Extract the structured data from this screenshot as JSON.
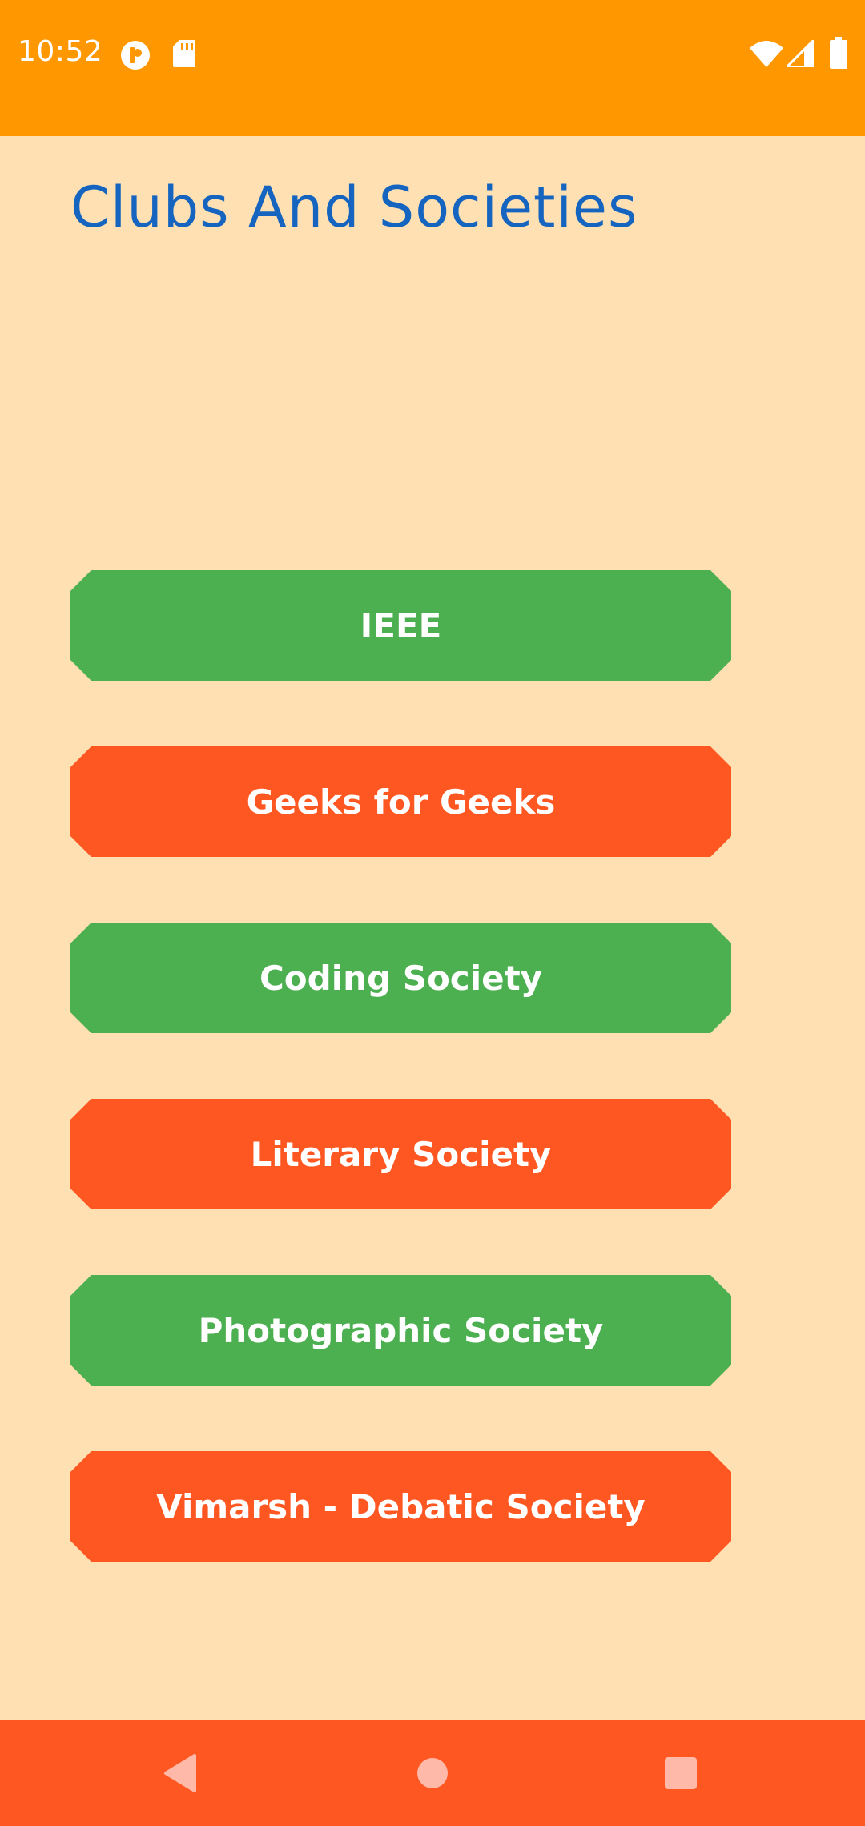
{
  "status_bar": {
    "time": "10:52",
    "background_color": "#FF9800",
    "left_icons": [
      "app-notification-icon",
      "sd-card-icon"
    ],
    "right_icons": [
      "wifi-icon",
      "cell-signal-icon",
      "battery-icon"
    ]
  },
  "page": {
    "title": "Clubs And Societies",
    "background_color": "#FFE0B2",
    "title_color": "#1565C0"
  },
  "clubs": [
    {
      "label": "IEEE",
      "color": "#4CAF50"
    },
    {
      "label": "Geeks for Geeks",
      "color": "#FF5722"
    },
    {
      "label": "Coding Society",
      "color": "#4CAF50"
    },
    {
      "label": "Literary Society",
      "color": "#FF5722"
    },
    {
      "label": "Photographic Society",
      "color": "#4CAF50"
    },
    {
      "label": "Vimarsh - Debatic Society",
      "color": "#FF5722"
    }
  ],
  "nav_bar": {
    "background_color": "#FF5722",
    "buttons": [
      "back-icon",
      "home-icon",
      "recents-icon"
    ]
  }
}
